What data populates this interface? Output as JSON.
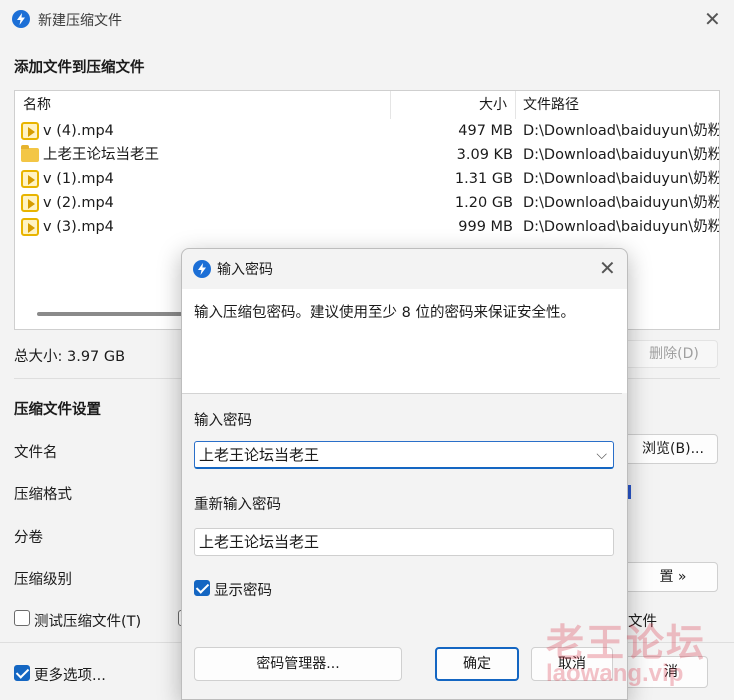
{
  "window": {
    "title": "新建压缩文件",
    "section_add": "添加文件到压缩文件",
    "columns": {
      "name": "名称",
      "size": "大小",
      "path": "文件路径"
    },
    "files": [
      {
        "icon": "video-file-icon",
        "name": "v (4).mp4",
        "size": "497 MB",
        "path": "D:\\Download\\baiduyun\\奶粉"
      },
      {
        "icon": "folder-icon",
        "name": "上老王论坛当老王",
        "size": "3.09 KB",
        "path": "D:\\Download\\baiduyun\\奶粉"
      },
      {
        "icon": "video-file-icon",
        "name": "v (1).mp4",
        "size": "1.31 GB",
        "path": "D:\\Download\\baiduyun\\奶粉"
      },
      {
        "icon": "video-file-icon",
        "name": "v (2).mp4",
        "size": "1.20 GB",
        "path": "D:\\Download\\baiduyun\\奶粉"
      },
      {
        "icon": "video-file-icon",
        "name": "v (3).mp4",
        "size": "999 MB",
        "path": "D:\\Download\\baiduyun\\奶粉"
      }
    ],
    "total_size": "总大小: 3.97 GB",
    "delete_button": "删除(D)",
    "settings_heading": "压缩文件设置",
    "labels": {
      "filename": "文件名",
      "format": "压缩格式",
      "volume": "分卷",
      "level": "压缩级别"
    },
    "browse_button": "浏览(B)...",
    "options_button": "置 »",
    "test_archive": "测试压缩文件(T)",
    "test_archive_checked": false,
    "partial_file": "文件",
    "more_options": "更多选项...",
    "more_options_checked": true,
    "cancel_partial": "消"
  },
  "dialog": {
    "title": "输入密码",
    "description": "输入压缩包密码。建议使用至少 8 位的密码来保证安全性。",
    "password_label": "输入密码",
    "password_value": "上老王论坛当老王",
    "reenter_label": "重新输入密码",
    "reenter_value": "上老王论坛当老王",
    "show_password": "显示密码",
    "show_password_checked": true,
    "manager_button": "密码管理器...",
    "ok_button": "确定",
    "cancel_button": "取消"
  },
  "watermark": {
    "text_cn": "老王论坛",
    "text_en": "laowang.vip"
  },
  "colors": {
    "accent": "#1466c2",
    "app_icon": "#1c6fd6",
    "watermark": "#d6283c"
  }
}
